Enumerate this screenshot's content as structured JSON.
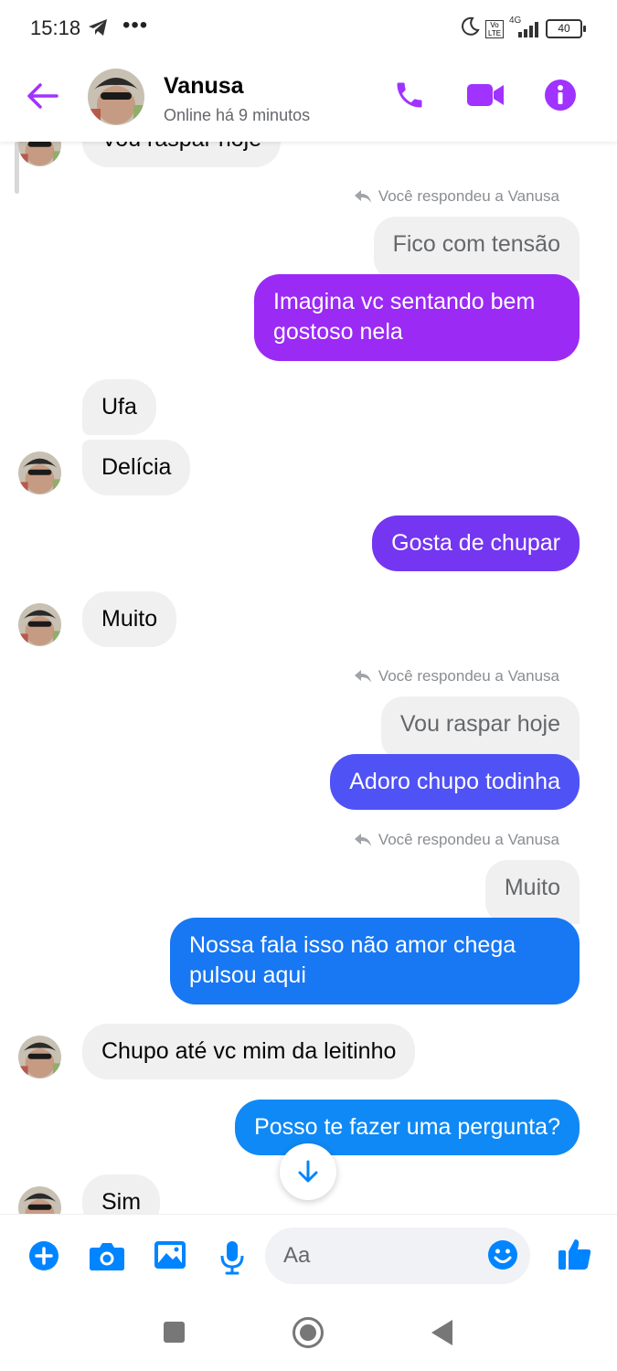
{
  "status_bar": {
    "time": "15:18",
    "dots": "•••",
    "network": "4G",
    "volte": "Vo LTE",
    "battery": "40"
  },
  "header": {
    "name": "Vanusa",
    "status": "Online há 9 minutos"
  },
  "chat": {
    "partial_top": "Vou raspar hoje",
    "reply_label": "Você respondeu a Vanusa",
    "quote_1": "Fico com tensão",
    "out_1": [
      "Imagina vc sentando bem",
      "gostoso nela"
    ],
    "in_1": "Ufa",
    "in_2": "Delícia",
    "out_2": "Gosta de chupar",
    "in_3": "Muito",
    "quote_2": "Vou raspar hoje",
    "out_3": "Adoro chupo todinha",
    "quote_3": "Muito",
    "out_4": [
      "Nossa fala isso não amor chega",
      "pulsou aqui"
    ],
    "in_4": "Chupo até vc mim da leitinho",
    "out_5": "Posso te fazer uma pergunta?",
    "in_5": "Sim"
  },
  "composer": {
    "placeholder": "Aa"
  },
  "colors": {
    "accent": "#a033ff",
    "out_purple": "#9b2af5",
    "out_violet": "#7436f0",
    "out_indigo": "#4f52f5",
    "out_blue": "#1877f2",
    "out_lightblue": "#0f89f5",
    "messenger_blue": "#0084ff"
  }
}
